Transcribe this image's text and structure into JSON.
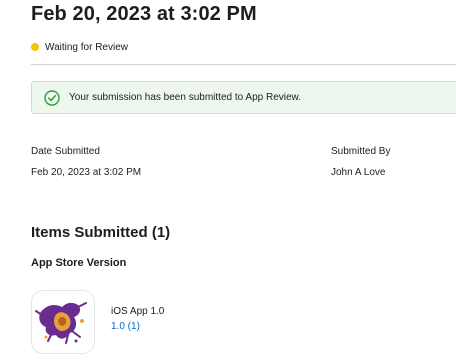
{
  "header": {
    "title": "Feb 20, 2023 at 3:02 PM",
    "status": {
      "text": "Waiting for Review",
      "color": "#f5c400"
    }
  },
  "banner": {
    "icon": "check-circle-icon",
    "text": "Your submission has been submitted to App Review.",
    "background": "#eef7ee",
    "accent": "#2e9e3a"
  },
  "details": {
    "date_submitted": {
      "label": "Date Submitted",
      "value": "Feb 20, 2023 at 3:02 PM"
    },
    "submitted_by": {
      "label": "Submitted By",
      "value": "John A Love"
    }
  },
  "items": {
    "title": "Items Submitted (1)",
    "section": "App Store Version",
    "list": [
      {
        "icon": "app-icon",
        "name": "iOS App 1.0",
        "version": "1.0 (1)",
        "link_color": "#0070c9"
      }
    ]
  }
}
